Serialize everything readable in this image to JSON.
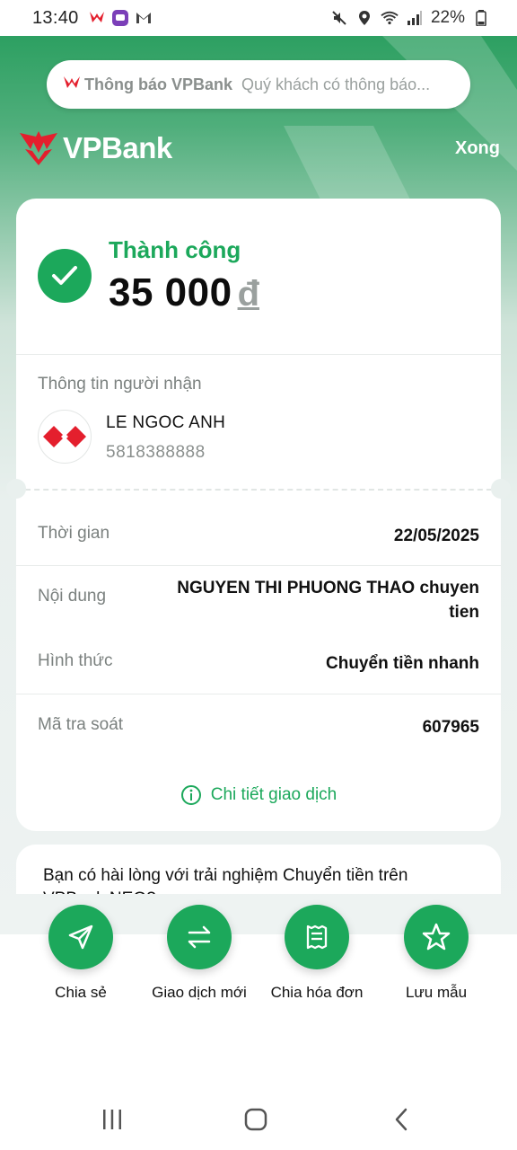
{
  "status_bar": {
    "time": "13:40",
    "battery": "22%"
  },
  "notice": {
    "title": "Thông báo VPBank",
    "text": "Quý khách có thông báo..."
  },
  "header": {
    "logo_text": "VPBank",
    "done_label": "Xong"
  },
  "result": {
    "status": "Thành công",
    "amount": "35 000",
    "currency": "đ"
  },
  "recipient": {
    "section_label": "Thông tin người nhận",
    "name": "LE NGOC ANH",
    "account": "5818388888"
  },
  "details": [
    {
      "label": "Thời gian",
      "value": "22/05/2025"
    },
    {
      "label": "Nội dung",
      "value": "NGUYEN THI PHUONG THAO chuyen tien"
    },
    {
      "label": "Hình thức",
      "value": "Chuyển tiền nhanh"
    },
    {
      "label": "Mã tra soát",
      "value": "607965"
    }
  ],
  "detail_link": "Chi tiết giao dịch",
  "survey": {
    "text": "Bạn có hài lòng với trải nghiệm Chuyển tiền trên VPBank NEO?"
  },
  "actions": [
    {
      "label": "Chia sẻ",
      "icon": "send-icon"
    },
    {
      "label": "Giao dịch mới",
      "icon": "swap-arrows-icon"
    },
    {
      "label": "Chia hóa đơn",
      "icon": "split-bill-icon"
    },
    {
      "label": "Lưu mẫu",
      "icon": "star-icon"
    }
  ],
  "colors": {
    "brand_green": "#1ca85b",
    "vpbank_red": "#e41f2d"
  }
}
